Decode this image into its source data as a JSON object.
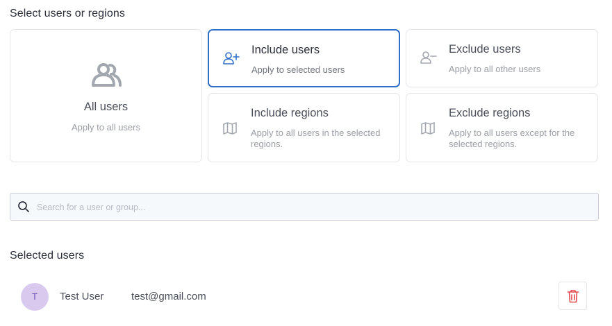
{
  "section_select": {
    "title": "Select users or regions"
  },
  "cards": {
    "all_users": {
      "title": "All users",
      "subtitle": "Apply to all users",
      "icon": "users-icon"
    },
    "include_users": {
      "title": "Include users",
      "subtitle": "Apply to selected users",
      "icon": "user-plus-icon",
      "selected": true
    },
    "exclude_users": {
      "title": "Exclude users",
      "subtitle": "Apply to all other users",
      "icon": "user-minus-icon"
    },
    "include_regions": {
      "title": "Include regions",
      "subtitle": "Apply to all users in the selected regions.",
      "icon": "map-icon"
    },
    "exclude_regions": {
      "title": "Exclude regions",
      "subtitle": "Apply to all users except for the selected regions.",
      "icon": "map-icon"
    }
  },
  "search": {
    "placeholder": "Search for a user or group...",
    "value": "",
    "icon": "search-icon"
  },
  "section_selected": {
    "title": "Selected users"
  },
  "selected_users": [
    {
      "initial": "T",
      "name": "Test User",
      "email": "test@gmail.com"
    }
  ],
  "colors": {
    "accent": "#2f6fc6",
    "avatar_bg": "#d9c9ef",
    "avatar_fg": "#6f4fb1",
    "danger": "#e5484d"
  }
}
